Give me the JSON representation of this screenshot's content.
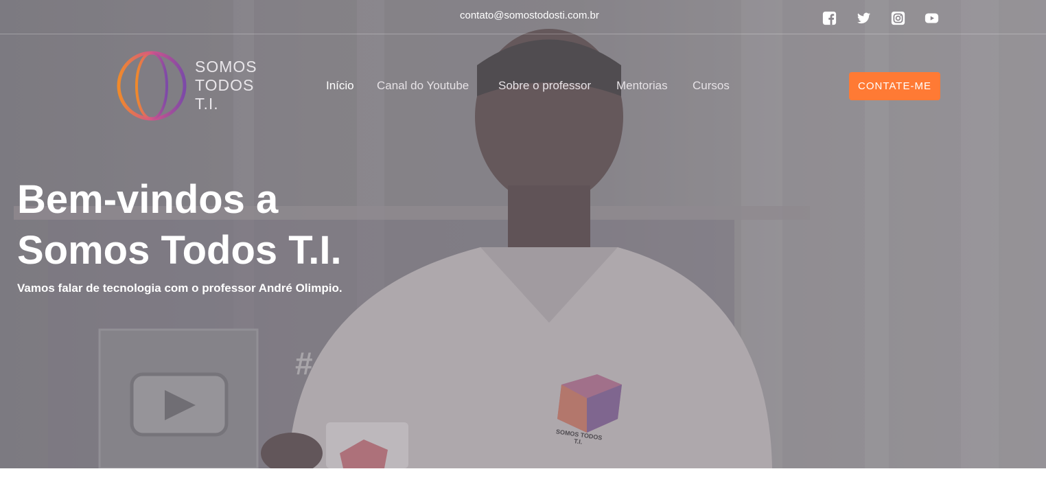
{
  "topbar": {
    "email": "contato@somostodosti.com.br",
    "social": [
      {
        "icon": "facebook-icon"
      },
      {
        "icon": "twitter-icon"
      },
      {
        "icon": "instagram-icon"
      },
      {
        "icon": "youtube-icon"
      }
    ]
  },
  "logo": {
    "line1": "SOMOS",
    "line2": "TODOS",
    "line3": "T.I."
  },
  "nav": {
    "items": [
      {
        "label": "Início"
      },
      {
        "label": "Canal do Youtube"
      },
      {
        "label": "Sobre o professor"
      },
      {
        "label": "Mentorias"
      },
      {
        "label": "Cursos"
      }
    ],
    "cta": "CONTATE-ME"
  },
  "hero": {
    "title_line1": "Bem-vindos a",
    "title_line2": "Somos Todos T.I.",
    "subtitle": "Vamos falar de tecnologia com o professor André Olimpio.",
    "shirt_logo": "SOMOS TODOS T.I."
  },
  "colors": {
    "accent": "#ff7a34"
  }
}
